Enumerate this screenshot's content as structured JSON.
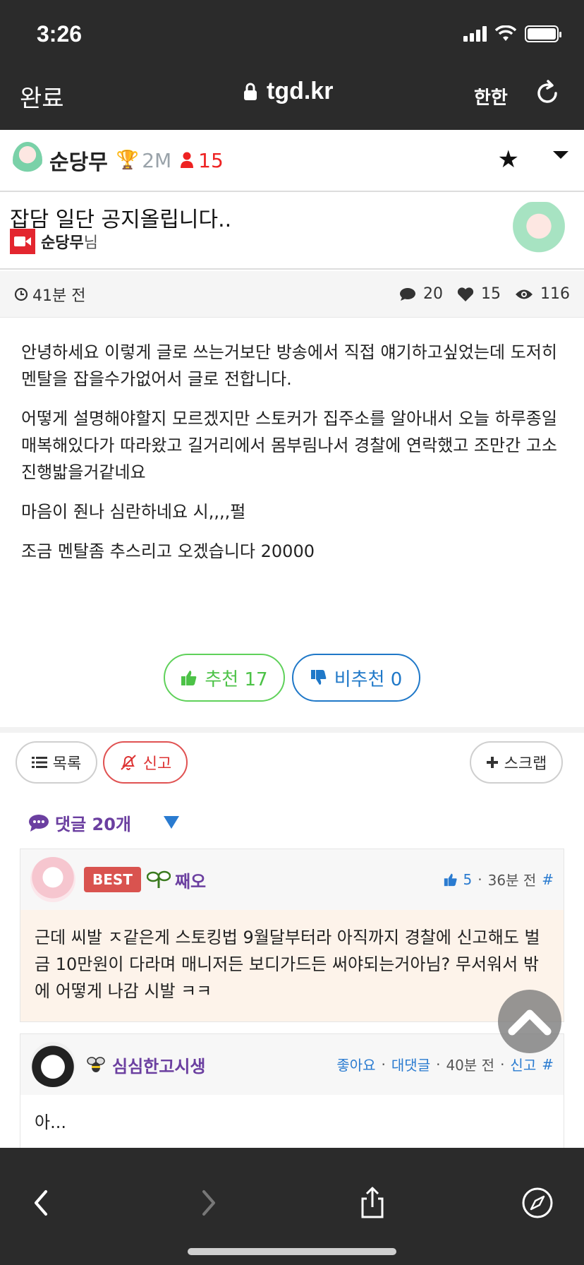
{
  "status_bar": {
    "time": "3:26"
  },
  "browser": {
    "done_label": "완료",
    "url": "tgd.kr",
    "lang_label": "한한"
  },
  "post": {
    "author": "순당무",
    "rank": "2M",
    "fans": "15",
    "title": "잡담 일단 공지올립니다..",
    "streamer_name": "순당무",
    "streamer_suffix": "님",
    "time_ago": "41분 전",
    "comments_count": "20",
    "likes_count": "15",
    "views_count": "116",
    "body": [
      "안녕하세요 이렇게 글로 쓰는거보단 방송에서 직접 얘기하고싶었는데 도저히 멘탈을 잡을수가없어서 글로 전합니다.",
      "어떻게 설명해야할지 모르겠지만 스토커가 집주소를 알아내서 오늘 하루종일 매복해있다가 따라왔고 길거리에서 몸부림나서 경찰에 연락했고 조만간 고소진행밟을거같네요",
      "마음이 줜나 심란하네요 시,,,,펄",
      "조금 멘탈좀 추스리고 오겠습니다 20000"
    ],
    "upvote_label": "추천 17",
    "downvote_label": "비추천 0"
  },
  "actions": {
    "list_label": "목록",
    "report_label": "신고",
    "scrap_label": "스크랩"
  },
  "comments_header": "댓글 20개",
  "comments": [
    {
      "badge": "BEST",
      "name": "째오",
      "likes": "5",
      "time": "36분 전",
      "hash": "#",
      "text": "근데 씨발 ㅈ같은게 스토킹법 9월달부터라 아직까지 경찰에 신고해도 벌금 10만원이 다라며 매니저든 보디가드든 써야되는거아님? 무서워서 밖에 어떻게 나감 시발 ㅋㅋ"
    },
    {
      "name": "심심한고시생",
      "like_label": "좋아요",
      "reply_label": "대댓글",
      "time": "40분 전",
      "report_label": "신고",
      "hash": "#",
      "text": "아..."
    }
  ],
  "colors": {
    "chrome": "#2b2b2b",
    "upvote": "#4cc247",
    "downvote": "#1f78c8",
    "accent_purple": "#6b3fa0",
    "best_badge": "#d9534f",
    "fans_red": "#e22222"
  }
}
